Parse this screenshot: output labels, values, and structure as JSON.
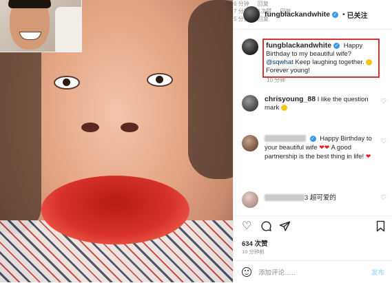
{
  "post": {
    "username": "fungblackandwhite",
    "follow_status": "已关注",
    "header_separator": "•"
  },
  "caption": {
    "username": "fungblackandwhite",
    "text_1": "Happy Birthday to my beautiful wife?",
    "mention": "@sqwhat",
    "text_2": "Keep laughing together.",
    "text_3": "Forever young!",
    "time": "10 分钟"
  },
  "comments": [
    {
      "username": "chrisyoung_88",
      "text": "I like the question mark",
      "time": "6 分钟",
      "reply": "回复"
    },
    {
      "text_1": "Happy Birthday to your beautiful wife",
      "text_2": "A good partnership is the best thing in life!",
      "time": "7 分钟",
      "likes": "1次赞",
      "reply": "回复"
    },
    {
      "text_suffix": "3 超可爱的",
      "time": "5 分钟",
      "reply": "回复"
    }
  ],
  "engagement": {
    "likes": "634 次赞",
    "time_ago": "10 分钟前"
  },
  "add_comment": {
    "placeholder": "添加评论......",
    "post_label": "发布"
  },
  "icons": [
    "heart-icon",
    "comment-icon",
    "share-icon",
    "bookmark-icon",
    "verified-badge-icon",
    "emoji-icon"
  ],
  "colors": {
    "highlight_border": "#d9342b",
    "link_blue": "#00376b",
    "verified": "#3897f0",
    "muted": "#8e8e8e",
    "post_button_disabled": "#b2dffc"
  }
}
